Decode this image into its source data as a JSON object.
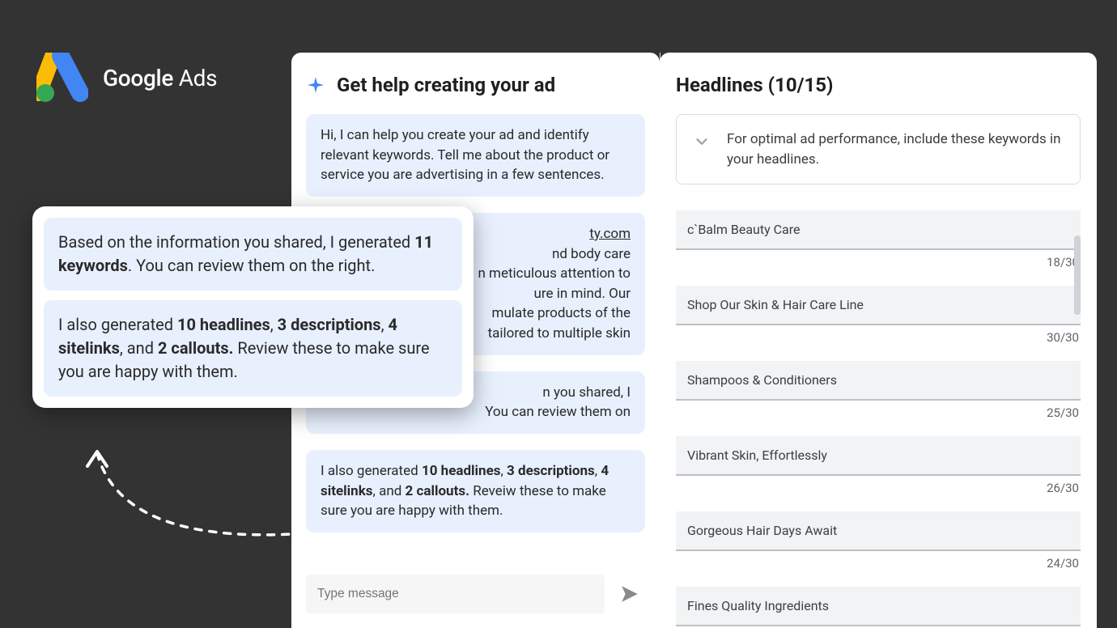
{
  "brand": {
    "name": "Google Ads"
  },
  "chat": {
    "title": "Get help creating your ad",
    "intro": "Hi, I can help you create your ad and identify relevant keywords. Tell me about the product or service you are advertising in a few sentences.",
    "site_link": "ty.com",
    "site_desc_line1": "nd body care",
    "site_desc_line2": "n meticulous attention to",
    "site_desc_line3": "ure in mind. Our",
    "site_desc_line4": "mulate products of the",
    "site_desc_line5": "tailored to multiple skin",
    "kw_prefix": "n you shared, I",
    "kw_suffix": "You can review them on",
    "gen": {
      "prefix": "I also generated ",
      "headlines": "10 headlines",
      "comma1": ", ",
      "descriptions": "3 descriptions",
      "comma2": ", ",
      "sitelinks": "4 sitelinks",
      "and": ", and ",
      "callouts": "2 callouts.",
      "tail": " Reveiw these to make sure you are happy with them."
    },
    "input_placeholder": "Type message"
  },
  "popout": {
    "kw": {
      "line1_a": "Based on the information you shared, I generated ",
      "kw": "11 keywords",
      "line1_b": ". You can review them on the right."
    },
    "gen": {
      "prefix": "I also generated ",
      "headlines": "10 headlines",
      "comma1": ", ",
      "descriptions": "3 descriptions",
      "comma2": ", ",
      "sitelinks": "4 sitelinks",
      "and": ", and ",
      "callouts": "2 callouts.",
      "tail": " Review these to make sure you are happy with them."
    }
  },
  "headlines": {
    "title": "Headlines (10/15)",
    "hint": "For optimal ad performance, include these keywords in your headlines.",
    "items": [
      {
        "text": "c`Balm Beauty Care",
        "count": "18/30"
      },
      {
        "text": "Shop Our Skin & Hair Care Line",
        "count": "30/30"
      },
      {
        "text": "Shampoos & Conditioners",
        "count": "25/30"
      },
      {
        "text": "Vibrant Skin, Effortlessly",
        "count": "26/30"
      },
      {
        "text": "Gorgeous Hair Days Await",
        "count": "24/30"
      },
      {
        "text": "Fines Quality Ingredients",
        "count": ""
      }
    ]
  }
}
